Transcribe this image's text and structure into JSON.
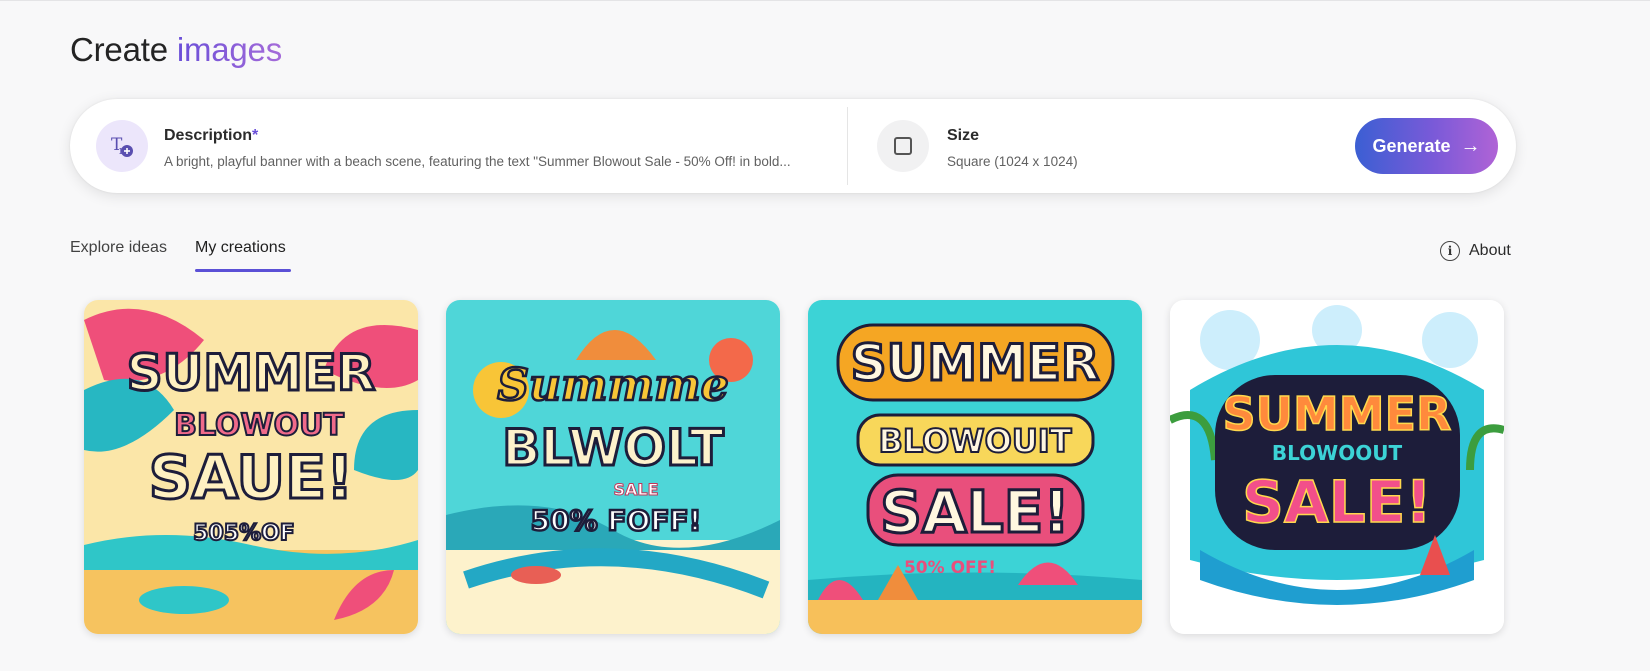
{
  "header": {
    "title_prefix": "Create",
    "title_accent": "images"
  },
  "prompt": {
    "description_label": "Description",
    "required_mark": "*",
    "description_value": "A bright, playful banner with a beach scene, featuring the text \"Summer Blowout Sale - 50% Off! in bold...",
    "size_label": "Size",
    "size_value": "Square (1024 x 1024)",
    "generate_label": "Generate",
    "description_icon": "text-add-icon",
    "size_icon": "square-icon",
    "generate_icon": "arrow-right-icon"
  },
  "tabs": [
    {
      "label": "Explore ideas",
      "active": false
    },
    {
      "label": "My creations",
      "active": true
    }
  ],
  "about": {
    "label": "About",
    "icon": "info-icon"
  },
  "creations": [
    {
      "line1": "SUMMER",
      "line2": "BLOWOUT",
      "line3": "SAUE!",
      "line4": "505%OF"
    },
    {
      "line1": "Summme",
      "line2": "BLWOLT",
      "line3": "SALE",
      "line4": "50% FOFF!"
    },
    {
      "line1": "SUMMER",
      "line2": "BLOWOUIT",
      "line3": "SALE!",
      "line4": "50% OFF!"
    },
    {
      "line1": "SUMMER",
      "line2": "BLOWOOUT",
      "line3": "SALE!",
      "line4": ""
    }
  ],
  "colors": {
    "accent": "#6a4fd8",
    "generate_gradient_start": "#3b5fd3",
    "generate_gradient_end": "#b063d6",
    "tab_underline": "#5b50d6"
  }
}
